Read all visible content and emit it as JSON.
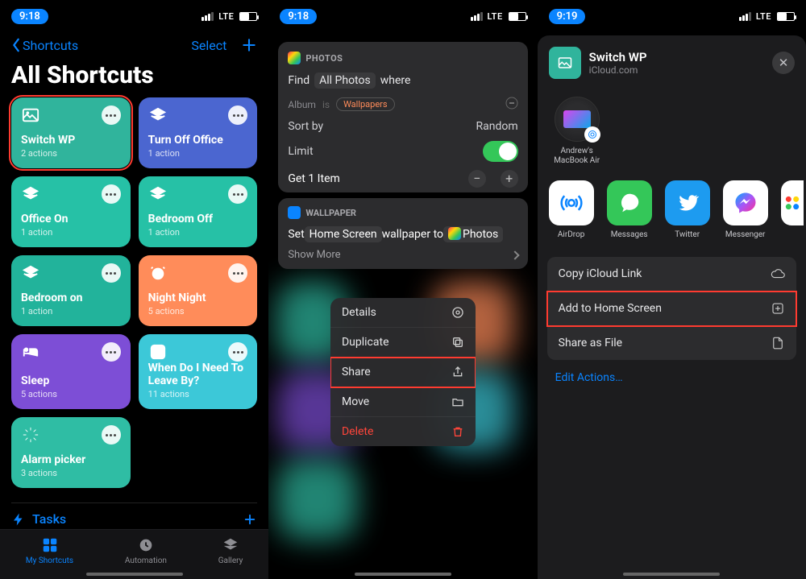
{
  "status": {
    "time_a": "9:18",
    "time_b": "9:18",
    "time_c": "9:19",
    "carrier": "LTE"
  },
  "s1": {
    "back": "Shortcuts",
    "select": "Select",
    "title": "All Shortcuts",
    "cards": [
      {
        "name": "Switch WP",
        "sub": "2 actions"
      },
      {
        "name": "Turn Off Office",
        "sub": "1 action"
      },
      {
        "name": "Office On",
        "sub": "1 action"
      },
      {
        "name": "Bedroom Off",
        "sub": "1 action"
      },
      {
        "name": "Bedroom on",
        "sub": "1 action"
      },
      {
        "name": "Night Night",
        "sub": "5 actions"
      },
      {
        "name": "Sleep",
        "sub": "5 actions"
      },
      {
        "name": "When Do I Need To Leave By?",
        "sub": "11 actions"
      },
      {
        "name": "Alarm picker",
        "sub": "3 actions"
      }
    ],
    "section": "Tasks",
    "tabs": [
      "My Shortcuts",
      "Automation",
      "Gallery"
    ]
  },
  "s2": {
    "photos_app": "PHOTOS",
    "find": "Find",
    "allphotos": "All Photos",
    "where": "where",
    "album": "Album",
    "is": "is",
    "wall": "Wallpapers",
    "sortby": "Sort by",
    "random": "Random",
    "limit": "Limit",
    "get1": "Get 1 Item",
    "wpapp": "WALLPAPER",
    "set": "Set",
    "hs": "Home Screen",
    "wpto": "wallpaper to",
    "photos": "Photos",
    "showmore": "Show More",
    "menu": {
      "details": "Details",
      "dup": "Duplicate",
      "share": "Share",
      "move": "Move",
      "delete": "Delete"
    }
  },
  "s3": {
    "title": "Switch WP",
    "sub": "iCloud.com",
    "target": "Andrew's MacBook Air",
    "apps": [
      "AirDrop",
      "Messages",
      "Twitter",
      "Messenger"
    ],
    "opts": {
      "copy": "Copy iCloud Link",
      "add": "Add to Home Screen",
      "file": "Share as File"
    },
    "edit": "Edit Actions…"
  }
}
